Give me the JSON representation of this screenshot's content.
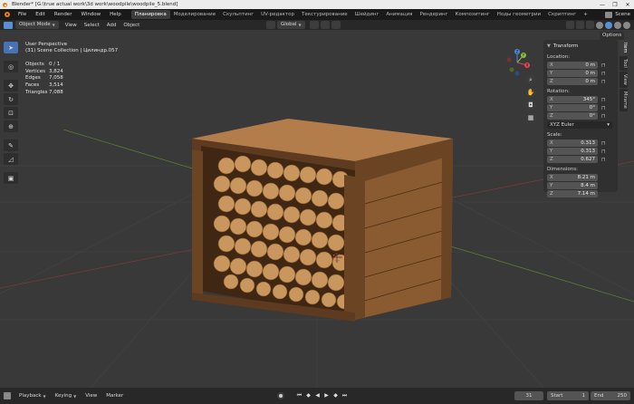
{
  "window": {
    "title": "Blender* [G:\\true actual work\\3d work\\woodpile\\woodpile_5.blend]",
    "controls": [
      "—",
      "❐",
      "✕"
    ]
  },
  "menubar": {
    "items": [
      "File",
      "Edit",
      "Render",
      "Window",
      "Help"
    ],
    "workspaces": [
      "Планировка",
      "Моделирование",
      "Скульптинг",
      "UV-редактор",
      "Текстурирование",
      "Шейдинг",
      "Анимация",
      "Рендеринг",
      "Композитинг",
      "Ноды геометрии",
      "Скриптинг"
    ],
    "active_workspace": 0,
    "add_workspace": "+",
    "scene_label": "Scene"
  },
  "viewport_header": {
    "mode": "Object Mode",
    "menus": [
      "View",
      "Select",
      "Add",
      "Object"
    ],
    "orientation": "Global",
    "options_label": "Options"
  },
  "overlay": {
    "view_name": "User Perspective",
    "collection": "(31) Scene Collection | Цилиндр.057",
    "stats": [
      {
        "label": "Objects",
        "value": "0 / 1"
      },
      {
        "label": "Vertices",
        "value": "3,824"
      },
      {
        "label": "Edges",
        "value": "7,058"
      },
      {
        "label": "Faces",
        "value": "3,514"
      },
      {
        "label": "Triangles",
        "value": "7,088"
      }
    ]
  },
  "gizmo": {
    "x": "X",
    "y": "Y",
    "z": "Z"
  },
  "npanel": {
    "header": "Transform",
    "location_label": "Location:",
    "location": [
      {
        "axis": "X",
        "value": "0 m"
      },
      {
        "axis": "Y",
        "value": "0 m"
      },
      {
        "axis": "Z",
        "value": "0 m"
      }
    ],
    "rotation_label": "Rotation:",
    "rotation": [
      {
        "axis": "X",
        "value": "345°"
      },
      {
        "axis": "Y",
        "value": "0°"
      },
      {
        "axis": "Z",
        "value": "0°"
      }
    ],
    "rotation_mode": "XYZ Euler",
    "scale_label": "Scale:",
    "scale": [
      {
        "axis": "X",
        "value": "0.313"
      },
      {
        "axis": "Y",
        "value": "0.313"
      },
      {
        "axis": "Z",
        "value": "0.627"
      }
    ],
    "dimensions_label": "Dimensions:",
    "dimensions": [
      {
        "axis": "X",
        "value": "8.21 m"
      },
      {
        "axis": "Y",
        "value": "8.4 m"
      },
      {
        "axis": "Z",
        "value": "7.14 m"
      }
    ],
    "tabs": [
      "Item",
      "Tool",
      "View",
      "Mirame"
    ]
  },
  "timeline": {
    "menus": [
      "Playback",
      "Keying",
      "View",
      "Marker"
    ],
    "current_frame": "31",
    "start_label": "Start",
    "start_value": "1",
    "end_label": "End",
    "end_value": "250"
  },
  "colors": {
    "accent": "#4772b3",
    "axis_x": "#e5454d",
    "axis_y": "#8ac23a",
    "axis_z": "#4f86e0",
    "wood": "#a86d3e"
  }
}
